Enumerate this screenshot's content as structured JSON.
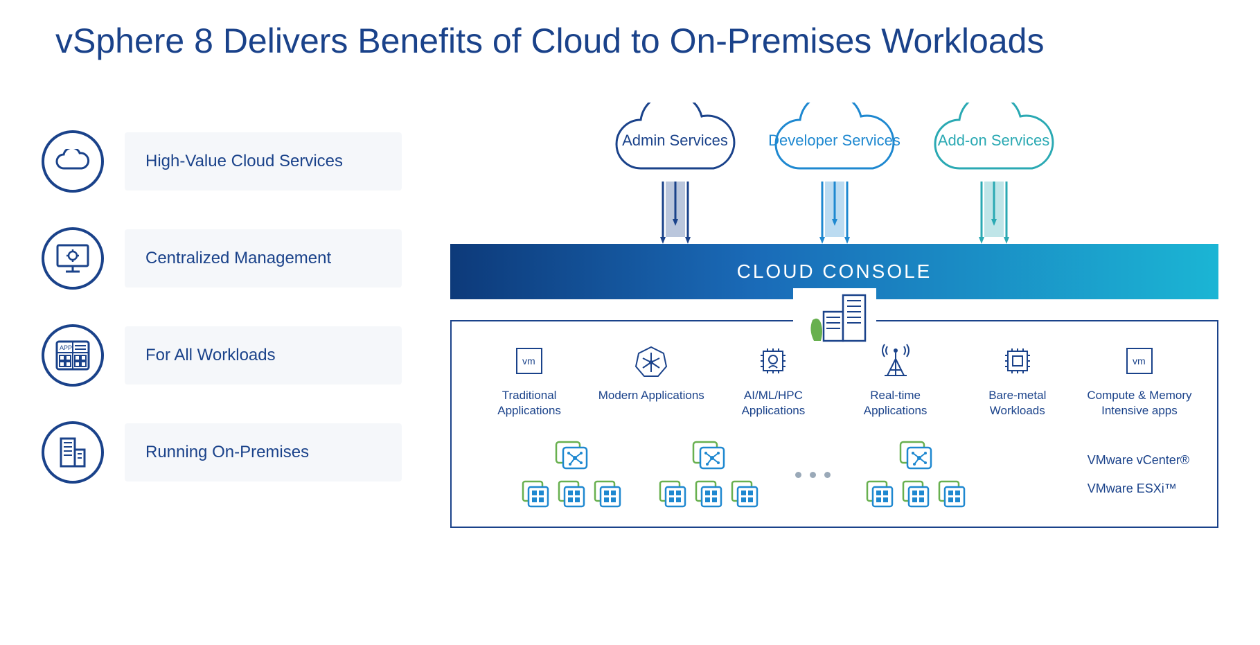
{
  "title": "vSphere 8 Delivers Benefits of Cloud to On-Premises Workloads",
  "benefits": [
    {
      "label": "High-Value Cloud Services",
      "icon": "cloud-icon"
    },
    {
      "label": "Centralized Management",
      "icon": "monitor-gear-icon"
    },
    {
      "label": "For All Workloads",
      "icon": "app-grid-icon"
    },
    {
      "label": "Running On-Premises",
      "icon": "building-icon"
    }
  ],
  "clouds": [
    {
      "label": "Admin Services",
      "color": "#1a428a"
    },
    {
      "label": "Developer Services",
      "color": "#1e88d0"
    },
    {
      "label": "Add-on Services",
      "color": "#2aa9b3"
    }
  ],
  "console_bar": "CLOUD CONSOLE",
  "workloads": [
    {
      "label": "Traditional Applications",
      "icon": "vm-box-icon"
    },
    {
      "label": "Modern Applications",
      "icon": "kubernetes-icon"
    },
    {
      "label": "AI/ML/HPC Applications",
      "icon": "ai-chip-icon"
    },
    {
      "label": "Real-time Applications",
      "icon": "antenna-icon"
    },
    {
      "label": "Bare-metal Workloads",
      "icon": "cpu-icon"
    },
    {
      "label": "Compute & Memory Intensive apps",
      "icon": "vm-box-icon"
    }
  ],
  "products": {
    "vcenter": "VMware vCenter®",
    "esxi": "VMware ESXi™"
  },
  "colors": {
    "navy": "#1a428a",
    "blue": "#1e88d0",
    "teal": "#2aa9b3",
    "green": "#68b04f"
  }
}
